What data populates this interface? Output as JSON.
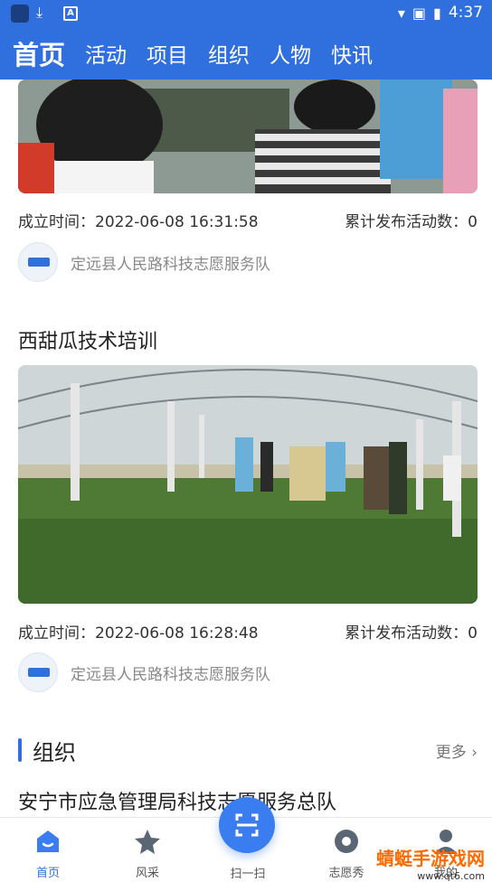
{
  "statusbar": {
    "time": "4:37",
    "icons": [
      "app-icon",
      "download-icon",
      "a-icon",
      "wifi-icon",
      "no-sim-icon",
      "battery-icon"
    ]
  },
  "nav": {
    "tabs": [
      {
        "label": "首页",
        "active": true
      },
      {
        "label": "活动"
      },
      {
        "label": "项目"
      },
      {
        "label": "组织"
      },
      {
        "label": "人物"
      },
      {
        "label": "快讯"
      }
    ]
  },
  "activities": [
    {
      "created_label": "成立时间：",
      "created_value": "2022-06-08 16:31:58",
      "count_label": "累计发布活动数：",
      "count_value": "0",
      "org_name": "定远县人民路科技志愿服务队"
    },
    {
      "title": "西甜瓜技术培训",
      "created_label": "成立时间：",
      "created_value": "2022-06-08 16:28:48",
      "count_label": "累计发布活动数：",
      "count_value": "0",
      "org_name": "定远县人民路科技志愿服务队"
    }
  ],
  "org_section": {
    "title": "组织",
    "more_label": "更多",
    "first_item": "安宁市应急管理局科技志愿服务总队"
  },
  "tabbar": {
    "home": "首页",
    "style": "风采",
    "scan": "扫一扫",
    "volunteer": "志愿秀",
    "mine": "我的"
  },
  "watermark": {
    "line1": "蜻蜓手游戏网",
    "line2": "www.qt6.com"
  },
  "colors": {
    "primary": "#2f6fde"
  }
}
